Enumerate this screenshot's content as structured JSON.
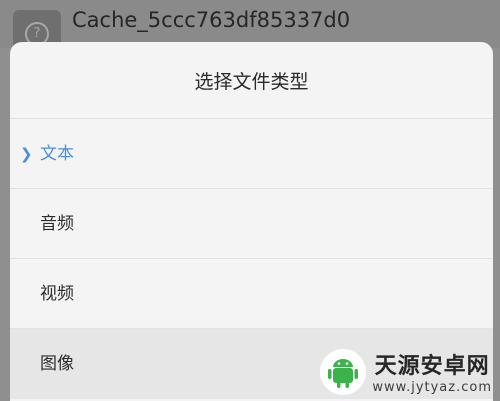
{
  "background": {
    "file_name": "Cache_5ccc763df85337d0"
  },
  "dialog": {
    "title": "选择文件类型",
    "options": [
      {
        "label": "文本",
        "selected": true
      },
      {
        "label": "音频",
        "selected": false
      },
      {
        "label": "视频",
        "selected": false
      },
      {
        "label": "图像",
        "selected": false
      }
    ]
  },
  "watermark": {
    "title": "天源安卓网",
    "url": "www.jytyaz.com"
  },
  "colors": {
    "accent": "#4a8fd8",
    "sheet_background": "#f4f4f4",
    "overlay": "#8f8f8f",
    "watermark_green": "#3bb34a"
  }
}
